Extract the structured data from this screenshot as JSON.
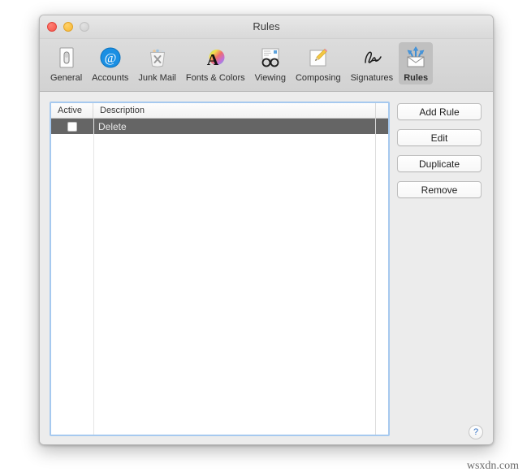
{
  "window": {
    "title": "Rules",
    "controls": {
      "close": "close-button",
      "minimize": "minimize-button",
      "zoom": "zoom-button-disabled"
    }
  },
  "toolbar": {
    "items": [
      {
        "label": "General",
        "icon": "general-icon",
        "selected": false
      },
      {
        "label": "Accounts",
        "icon": "accounts-at-icon",
        "selected": false
      },
      {
        "label": "Junk Mail",
        "icon": "junk-mail-trash-icon",
        "selected": false
      },
      {
        "label": "Fonts & Colors",
        "icon": "fonts-colors-icon",
        "selected": false
      },
      {
        "label": "Viewing",
        "icon": "viewing-glasses-icon",
        "selected": false
      },
      {
        "label": "Composing",
        "icon": "composing-pencil-icon",
        "selected": false
      },
      {
        "label": "Signatures",
        "icon": "signature-icon",
        "selected": false
      },
      {
        "label": "Rules",
        "icon": "rules-envelope-icon",
        "selected": true
      }
    ]
  },
  "rules_table": {
    "columns": [
      "Active",
      "Description"
    ],
    "rows": [
      {
        "active": false,
        "description": "Delete",
        "selected": true
      }
    ]
  },
  "buttons": {
    "add_rule": "Add Rule",
    "edit": "Edit",
    "duplicate": "Duplicate",
    "remove": "Remove"
  },
  "help": {
    "label": "?"
  },
  "watermark": {
    "text": "wsxdn.com"
  },
  "colors": {
    "selection_row": "#656565",
    "focus_ring": "#a6c9ef",
    "accent_blue": "#2f6fc4",
    "toolbar_bg": "#d6d6d6"
  }
}
